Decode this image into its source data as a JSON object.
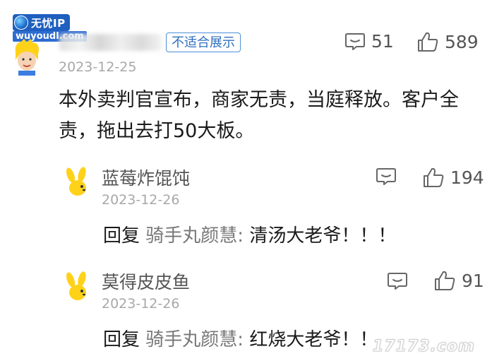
{
  "watermark_top": {
    "brand": "无忧IP",
    "url": "wuyoudl.com"
  },
  "main_comment": {
    "badge": "不适合展示",
    "date": "2023-12-25",
    "text": "本外卖判官宣布，商家无责，当庭释放。客户全责，拖出去打50大板。",
    "reply_count": "51",
    "like_count": "589"
  },
  "replies": [
    {
      "name": "蓝莓炸馄饨",
      "date": "2023-12-26",
      "reply_word": "回复",
      "target": "骑手丸颜慧:",
      "text": "清汤大老爷！！！",
      "like_count": "194"
    },
    {
      "name": "莫得皮皮鱼",
      "date": "2023-12-26",
      "reply_word": "回复",
      "target": "骑手丸颜慧:",
      "text": "红烧大老爷！！",
      "like_count": "91"
    }
  ],
  "watermark_bottom": "17173.com",
  "icons": {
    "comment": "comment-icon",
    "like": "thumbs-up-icon",
    "avatar_main": "yellow-hair-avatar",
    "avatar_reply": "yellow-bunny-avatar"
  },
  "colors": {
    "badge_border": "#4a90d9",
    "date": "#a8a8a8",
    "avatar_yellow": "#ffd21a"
  }
}
